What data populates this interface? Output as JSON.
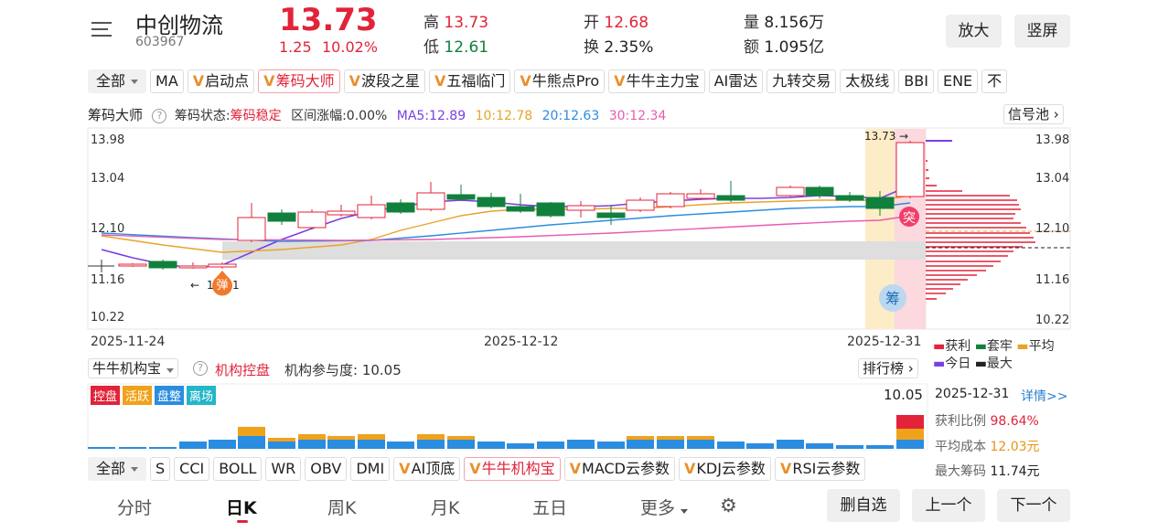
{
  "header": {
    "name": "中创物流",
    "code": "603967",
    "price": "13.73",
    "change": "1.25",
    "change_pct": "10.02%",
    "high_label": "高",
    "high": "13.73",
    "low_label": "低",
    "low": "12.61",
    "open_label": "开",
    "open": "12.68",
    "turnover_label": "换",
    "turnover": "2.35%",
    "volume_label": "量",
    "volume": "8.156万",
    "amount_label": "额",
    "amount": "1.095亿",
    "zoom_button": "放大",
    "portrait_button": "竖屏"
  },
  "indicator_bar": {
    "all": "全部",
    "items": [
      "MA",
      "启动点",
      "筹码大师",
      "波段之星",
      "五福临门",
      "牛熊点Pro",
      "牛牛主力宝",
      "AI雷达",
      "九转交易",
      "太极线",
      "BBI",
      "ENE",
      "不"
    ],
    "premium": [
      false,
      true,
      true,
      true,
      true,
      true,
      true,
      false,
      false,
      false,
      false,
      false,
      false
    ],
    "selected_index": 2
  },
  "chart_info": {
    "name": "筹码大师",
    "status_label": "筹码状态:",
    "status": "筹码稳定",
    "range_label": "区间涨幅:0.00%",
    "ma5": "MA5:12.89",
    "ma10": "10:12.78",
    "ma20": "20:12.63",
    "ma30": "30:12.34",
    "signal_pool": "信号池",
    "colors": {
      "ma5": "#7b3fe4",
      "ma10": "#e8a32a",
      "ma20": "#2a8de0",
      "ma30": "#e95bb0",
      "up": "#e2233a",
      "down": "#12803d"
    }
  },
  "price_axis": {
    "left": [
      "13.98",
      "13.04",
      "12.10",
      "11.16",
      "10.22"
    ],
    "right": [
      "13.98",
      "13.04",
      "12.10",
      "11.16",
      "10.22"
    ]
  },
  "date_axis": [
    "2025-11-24",
    "2025-12-12",
    "2025-12-31"
  ],
  "annotations": {
    "high_mark": "13.73",
    "low_mark": "1",
    "low_mark_right": "1",
    "bounce": "弹",
    "breakout": "突",
    "chip": "筹"
  },
  "chip_legend": {
    "profit": "获利",
    "trapped": "套牢",
    "average": "平均",
    "today": "今日",
    "max": "最大"
  },
  "sub_chart": {
    "name": "牛牛机构宝",
    "label": "机构控盘",
    "participation": "机构参与度: 10.05",
    "ranking": "排行榜",
    "tags": [
      "控盘",
      "活跃",
      "盘整",
      "离场"
    ],
    "tag_colors": [
      "#e2233a",
      "#f0a21b",
      "#2a8de0",
      "#23b6c8"
    ],
    "value": "10.05"
  },
  "chip_panel": {
    "date": "2025-12-31",
    "detail": "详情>>",
    "profit_ratio_label": "获利比例",
    "profit_ratio": "98.64%",
    "avg_cost_label": "平均成本",
    "avg_cost": "12.03元",
    "max_chip_label": "最大筹码",
    "max_chip": "11.74元"
  },
  "indicator_bar2": {
    "all": "全部",
    "items": [
      "S",
      "CCI",
      "BOLL",
      "WR",
      "OBV",
      "DMI",
      "AI顶底",
      "牛牛机构宝",
      "MACD云参数",
      "KDJ云参数",
      "RSI云参数"
    ],
    "premium": [
      false,
      false,
      false,
      false,
      false,
      false,
      true,
      true,
      true,
      true,
      true
    ],
    "selected_index": 7
  },
  "bottom_tabs": {
    "items": [
      "分时",
      "日K",
      "周K",
      "月K",
      "五日",
      "更多"
    ],
    "active_index": 1,
    "delete": "删自选",
    "prev": "上一个",
    "next": "下一个"
  }
}
